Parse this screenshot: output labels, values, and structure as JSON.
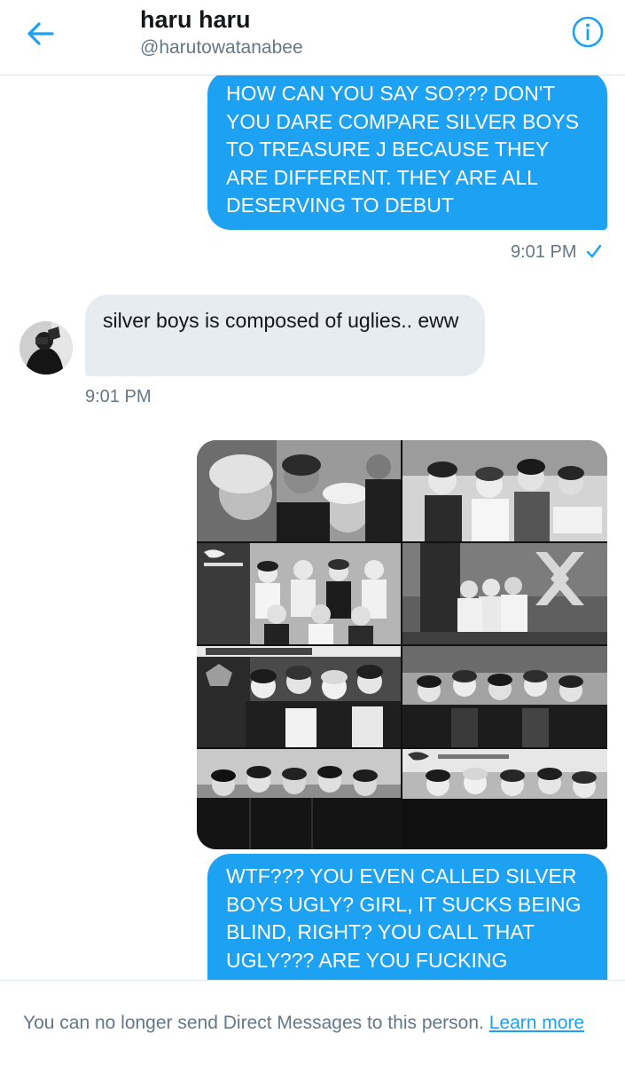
{
  "header": {
    "title": "haru haru",
    "handle": "@harutowatanabee",
    "back_icon": "arrow-left-icon",
    "info_icon": "info-icon"
  },
  "messages": [
    {
      "direction": "sent",
      "text": "HOW CAN YOU SAY SO??? DON'T YOU DARE COMPARE SILVER BOYS TO TREASURE J BECAUSE THEY ARE DIFFERENT. THEY ARE ALL DESERVING TO DEBUT",
      "time": "9:01 PM",
      "status_icon": "checkmark-icon"
    },
    {
      "direction": "received",
      "text": "silver boys is composed of uglies.. eww",
      "time": "9:01 PM"
    },
    {
      "direction": "sent",
      "type": "image",
      "image": "black-and-white photo collage of group members"
    },
    {
      "direction": "sent",
      "text": "WTF??? YOU EVEN CALLED SILVER BOYS UGLY? GIRL, IT SUCKS BEING BLIND, RIGHT? YOU CALL THAT UGLY??? ARE YOU FUCKING SERIOUS"
    }
  ],
  "footer": {
    "notice": "You can no longer send Direct Messages to this person.",
    "link": "Learn more"
  },
  "colors": {
    "accent": "#1da1f2",
    "received_bubble": "#e6ecf0",
    "secondary_text": "#657786"
  }
}
